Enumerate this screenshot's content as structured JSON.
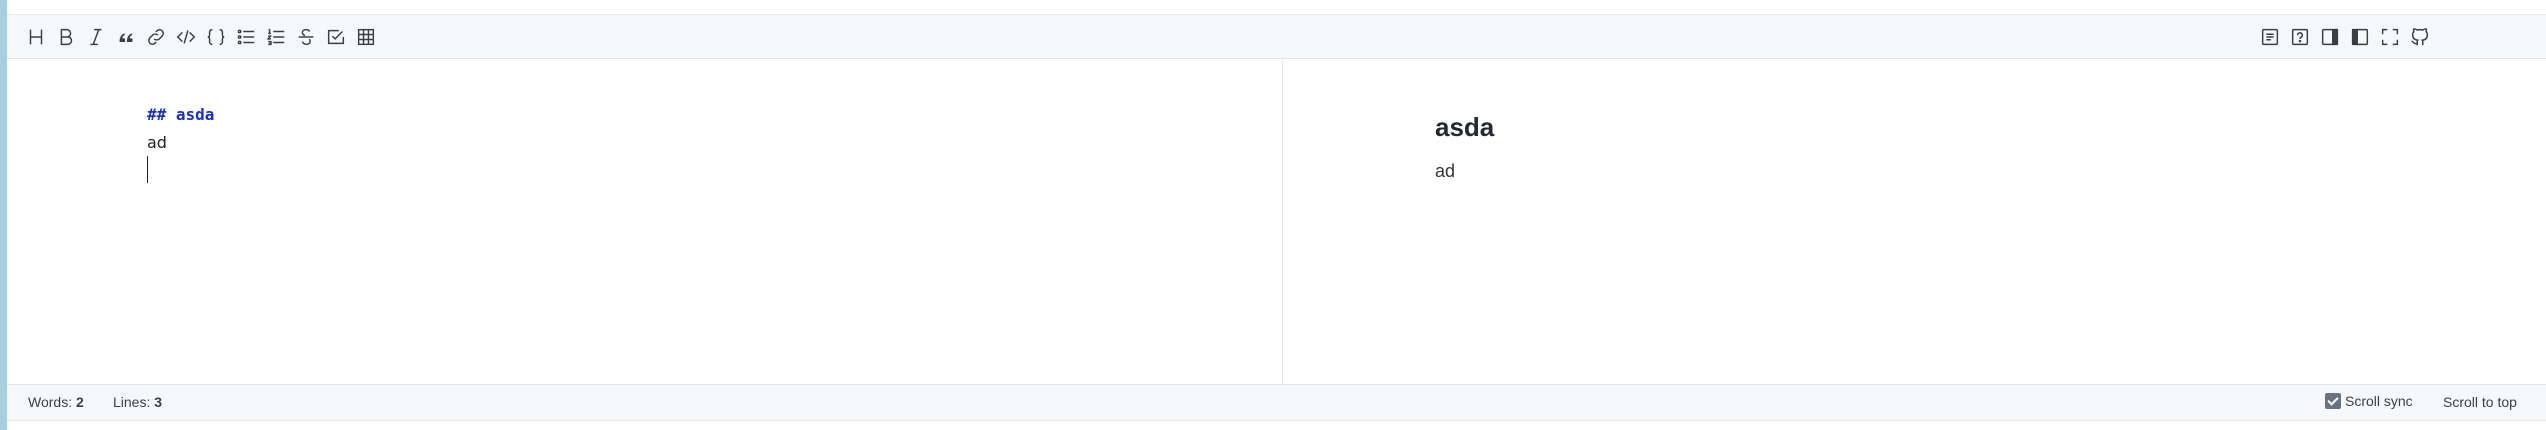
{
  "toolbar": {
    "left_tools": [
      {
        "name": "heading-button",
        "icon": "heading-icon",
        "glyph": "H"
      },
      {
        "name": "bold-button",
        "icon": "bold-icon",
        "glyph": "B"
      },
      {
        "name": "italic-button",
        "icon": "italic-icon",
        "glyph": "I"
      },
      {
        "name": "quote-button",
        "icon": "quote-icon",
        "glyph": "“"
      },
      {
        "name": "link-button",
        "icon": "link-icon"
      },
      {
        "name": "inline-code-button",
        "icon": "code-icon",
        "glyph": "</>"
      },
      {
        "name": "code-block-button",
        "icon": "braces-icon",
        "glyph": "{ }"
      },
      {
        "name": "unordered-list-button",
        "icon": "unordered-list-icon"
      },
      {
        "name": "ordered-list-button",
        "icon": "ordered-list-icon"
      },
      {
        "name": "strikethrough-button",
        "icon": "strikethrough-icon",
        "glyph": "S"
      },
      {
        "name": "task-list-button",
        "icon": "checkbox-icon"
      },
      {
        "name": "table-button",
        "icon": "table-icon"
      }
    ],
    "right_tools": [
      {
        "name": "write-mode-button",
        "icon": "document-icon"
      },
      {
        "name": "help-button",
        "icon": "help-icon"
      },
      {
        "name": "preview-only-button",
        "icon": "preview-pane-icon"
      },
      {
        "name": "editor-only-button",
        "icon": "editor-pane-icon"
      },
      {
        "name": "fullscreen-button",
        "icon": "fullscreen-icon"
      },
      {
        "name": "github-button",
        "icon": "github-icon"
      }
    ]
  },
  "editor": {
    "lines": [
      {
        "text": "## asda",
        "style": "heading"
      },
      {
        "text": "ad",
        "style": "plain"
      },
      {
        "text": "",
        "style": "plain"
      }
    ]
  },
  "preview": {
    "heading": "asda",
    "paragraph": "ad"
  },
  "status": {
    "words_label": "Words:",
    "words_value": "2",
    "lines_label": "Lines:",
    "lines_value": "3",
    "scroll_sync_label": "Scroll sync",
    "scroll_sync_checked": true,
    "scroll_top_label": "Scroll to top"
  }
}
